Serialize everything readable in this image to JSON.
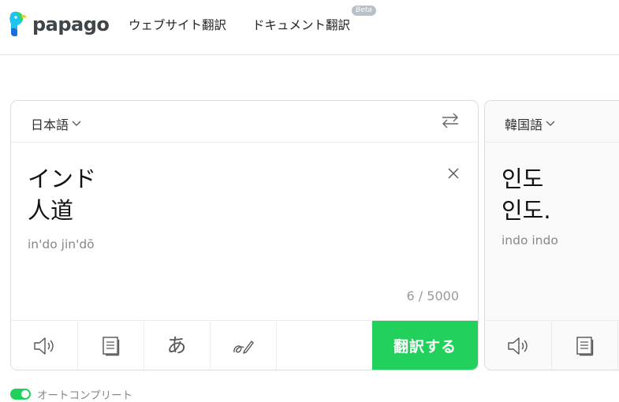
{
  "header": {
    "logo_text": "papago",
    "nav": {
      "website_translation": "ウェブサイト翻訳",
      "document_translation": "ドキュメント翻訳",
      "beta_badge": "Beta"
    }
  },
  "source_panel": {
    "language": "日本語",
    "text_lines": [
      "インド",
      "人道"
    ],
    "romanization": "in'do jin'dō",
    "char_count": "6 / 5000",
    "translate_button": "翻訳する",
    "tools": [
      "speaker-icon",
      "document-icon",
      "hiragana-icon",
      "handwriting-icon"
    ],
    "hiragana_glyph": "あ"
  },
  "target_panel": {
    "language": "韓国語",
    "text_lines": [
      "인도",
      "인도."
    ],
    "romanization": "indo indo",
    "tools": [
      "speaker-icon",
      "document-icon"
    ]
  },
  "autocomplete": {
    "label": "オートコンプリート",
    "enabled": true
  },
  "colors": {
    "accent_green": "#21d15c",
    "text_gray": "#888888",
    "border": "#dcdcdc"
  }
}
